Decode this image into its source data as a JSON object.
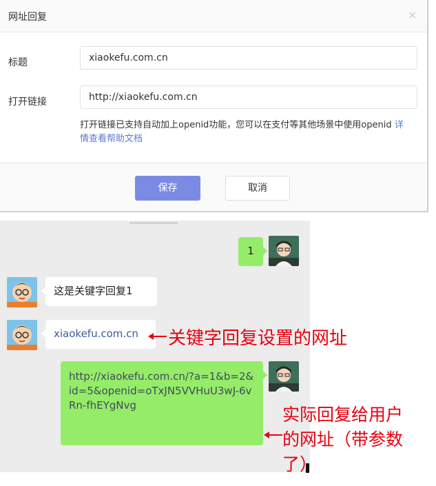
{
  "dialog": {
    "title": "网址回复",
    "close": "×",
    "title_label": "标题",
    "title_value": "xiaokefu.com.cn",
    "link_label": "打开链接",
    "link_value": "http://xiaokefu.com.cn",
    "help_text": "打开链接已支持自动加上openid功能，您可以在支付等其他场景中使用openid ",
    "help_link": "详情查看帮助文档",
    "save": "保存",
    "cancel": "取消"
  },
  "chat": {
    "msg_sent_1": "1",
    "msg_reply_1": "这是关键字回复1",
    "msg_reply_2": "xiaokefu.com.cn",
    "msg_reply_3": "http://xiaokefu.com.cn/?a=1&b=2&id=5&openid=oTxJN5VVHuU3wJ-6vRn-fhEYgNvg"
  },
  "annotations": {
    "keyword_url": "关键字回复设置的网址",
    "actual_url_line1": "实际回复给用户",
    "actual_url_line2": "的网址（带参数",
    "actual_url_line3": "了）"
  },
  "colors": {
    "primary_button": "#7b8be4",
    "sent_bubble": "#95ec69",
    "annotation_red": "#e60012",
    "help_link": "#5a79d6"
  },
  "icons": {
    "close": "close-icon",
    "user_avatar": "user-avatar-icon",
    "bot_avatar": "cartoon-avatar-icon"
  }
}
